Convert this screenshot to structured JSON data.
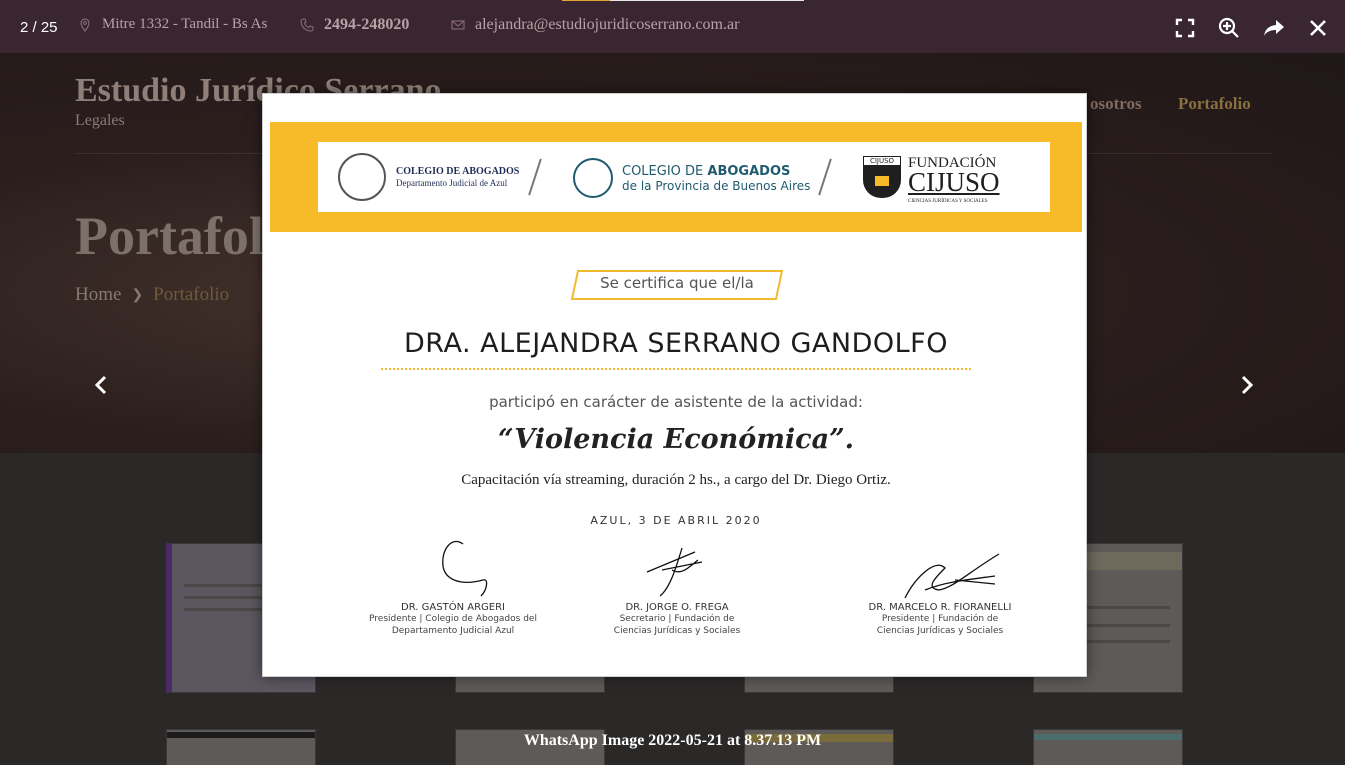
{
  "site": {
    "address": "Mitre 1332 - Tandil - Bs As",
    "phone": "2494-248020",
    "email": "alejandra@estudiojuridicoserrano.com.ar",
    "brand_name": "Estudio Jurídico Serrano",
    "brand_sub": "Legales",
    "nav": [
      "osotros",
      "Portafolio"
    ],
    "page_title": "Portafolio",
    "breadcrumb_home": "Home",
    "breadcrumb_current": "Portafolio"
  },
  "lightbox": {
    "counter": "2 / 25",
    "caption": "WhatsApp Image 2022-05-21 at 8.37.13 PM",
    "progress": 0.2
  },
  "certificate": {
    "logo1_title": "COLEGIO DE ABOGADOS",
    "logo1_sub": "Departamento Judicial de Azul",
    "logo2_title_a": "COLEGIO DE",
    "logo2_title_b": "ABOGADOS",
    "logo2_sub": "de la Provincia de Buenos Aires",
    "logo3_small": "CIJUSO",
    "logo3_title_a": "FUNDACIÓN",
    "logo3_title_b": "CIJUSO",
    "logo3_sub": "CIENCIAS JURÍDICAS Y SOCIALES",
    "badge": "Se certifica que el/la",
    "name": "DRA. ALEJANDRA SERRANO GANDOLFO",
    "role": "participó en carácter de asistente de la actividad:",
    "activity": "“Violencia Económica”.",
    "detail": "Capacitación vía streaming, duración 2 hs., a cargo del  Dr. Diego Ortiz.",
    "date": "AZUL, 3 DE ABRIL 2020",
    "signatures": [
      {
        "name": "DR. GASTÓN ARGERI",
        "role1": "Presidente | Colegio de Abogados del",
        "role2": "Departamento Judicial Azul"
      },
      {
        "name": "DR. JORGE O. FREGA",
        "role1": "Secretario | Fundación de",
        "role2": "Ciencias Jurídicas y Sociales"
      },
      {
        "name": "DR. MARCELO R. FIORANELLI",
        "role1": "Presidente | Fundación de",
        "role2": "Ciencias Jurídicas y Sociales"
      }
    ]
  },
  "colors": {
    "accent_yellow": "#f7bb2a",
    "overlay_dark": "#2b2828",
    "progress_fill": "#e8a23a"
  },
  "icons": [
    "location-icon",
    "phone-icon",
    "mail-icon",
    "fullscreen-icon",
    "zoom-in-icon",
    "share-icon",
    "close-icon",
    "chevron-left-icon",
    "chevron-right-icon"
  ]
}
